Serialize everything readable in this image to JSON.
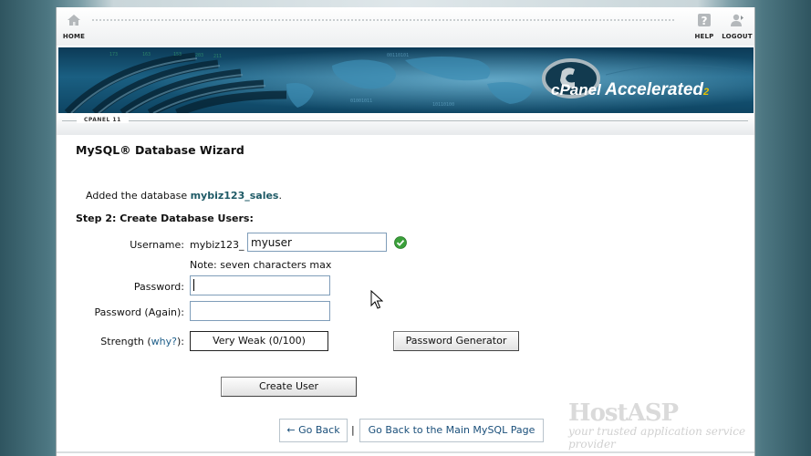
{
  "topbar": {
    "home_label": "HOME",
    "help_label": "HELP",
    "logout_label": "LOGOUT"
  },
  "banner": {
    "logo_cpanel": "cPanel",
    "logo_accelerated": "Accelerated",
    "logo_two": "2",
    "version_label": "CPANEL 11"
  },
  "content": {
    "title": "MySQL® Database Wizard",
    "added_prefix": "Added the database ",
    "database_name": "mybiz123_sales",
    "added_suffix": ".",
    "step_heading": "Step 2: Create Database Users:",
    "username_label": "Username:",
    "username_prefix": "mybiz123_",
    "username_value": "myuser",
    "username_note": "Note: seven characters max",
    "password_label": "Password:",
    "password_value": "",
    "password_again_label": "Password (Again):",
    "password_again_value": "",
    "strength_label": "Strength (",
    "strength_link": "why?",
    "strength_label_end": "):",
    "strength_value": "Very Weak (0/100)",
    "password_generator_label": "Password Generator",
    "create_user_label": "Create User",
    "go_back_label": "← Go Back",
    "separator": "|",
    "back_main_label": "Go Back to the Main MySQL Page"
  },
  "watermark": {
    "brand": "HostASP",
    "tagline": "your trusted application service provider"
  },
  "colors": {
    "link": "#1f5f8a",
    "db_name": "#1e5a66",
    "valid_check": "#3aa03a"
  }
}
